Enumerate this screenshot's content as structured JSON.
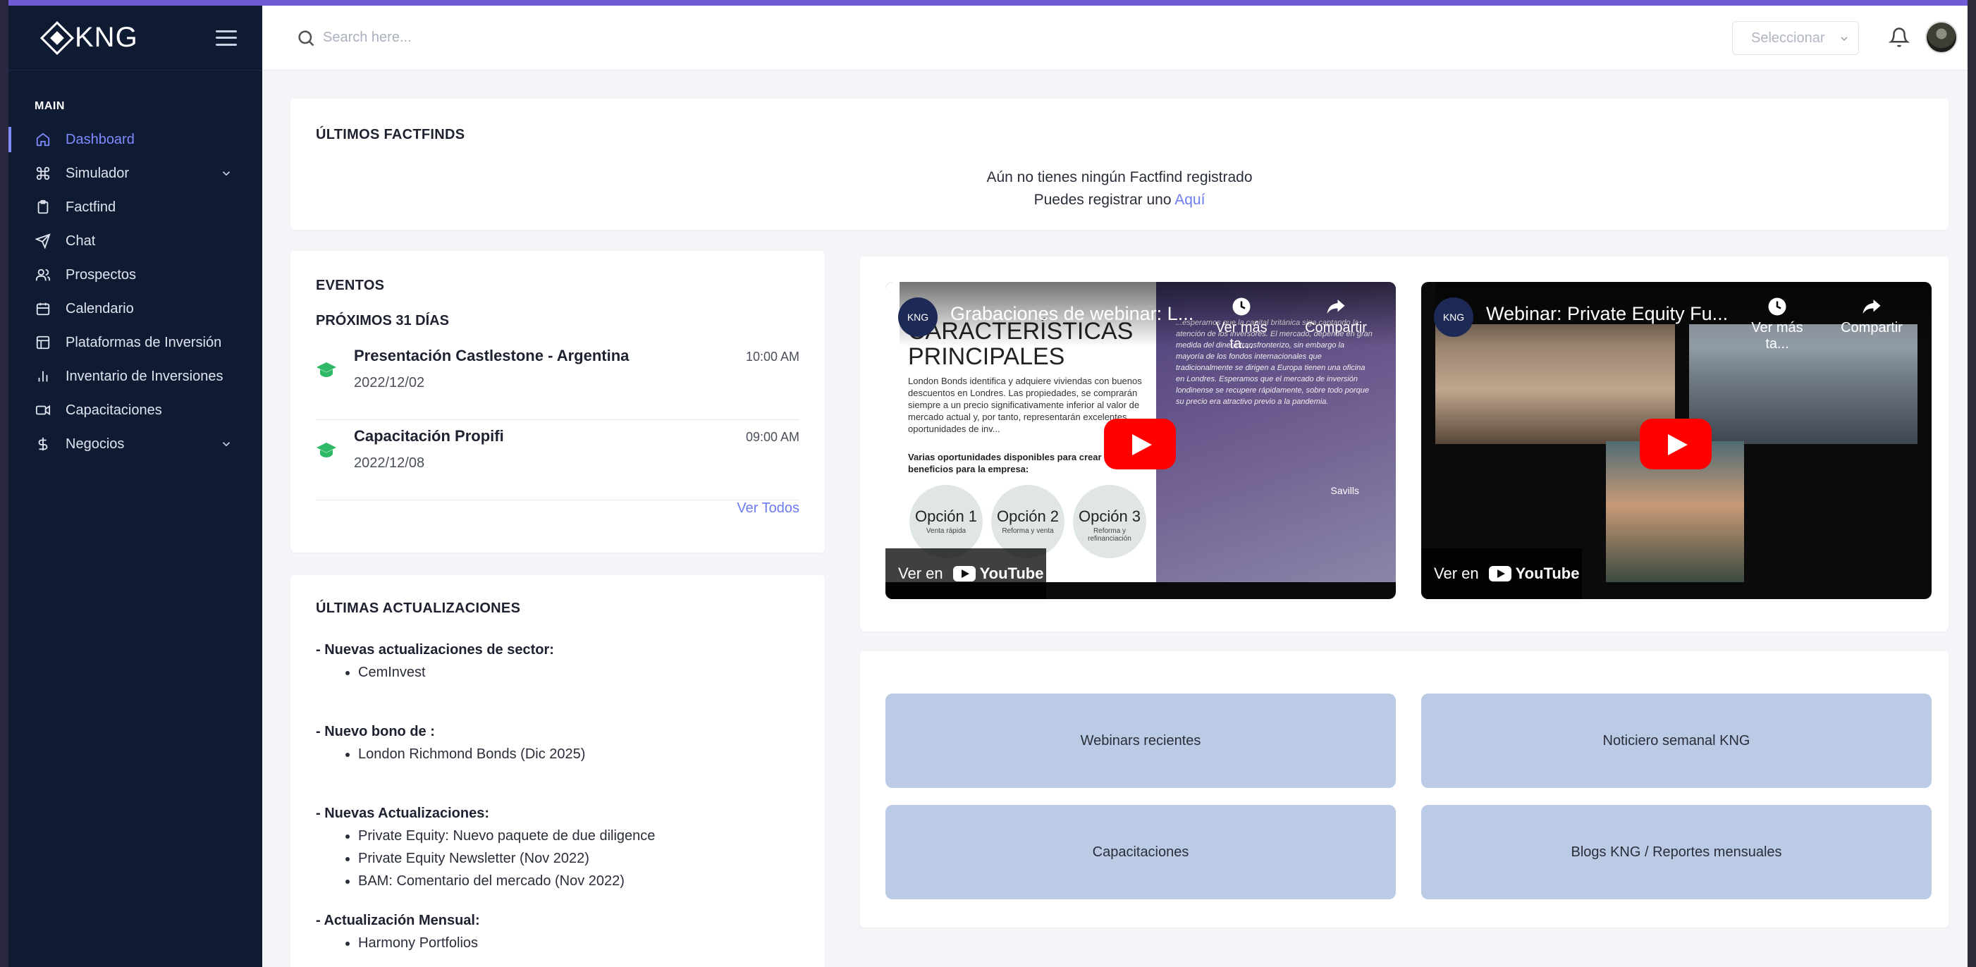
{
  "brand": {
    "name": "KNG"
  },
  "sidebar": {
    "section": "MAIN",
    "items": [
      {
        "label": "Dashboard",
        "icon": "home-icon",
        "active": true
      },
      {
        "label": "Simulador",
        "icon": "command-icon",
        "expandable": true
      },
      {
        "label": "Factfind",
        "icon": "clipboard-icon"
      },
      {
        "label": "Chat",
        "icon": "send-icon"
      },
      {
        "label": "Prospectos",
        "icon": "users-icon"
      },
      {
        "label": "Calendario",
        "icon": "calendar-icon"
      },
      {
        "label": "Plataformas de Inversión",
        "icon": "layout-icon"
      },
      {
        "label": "Inventario de Inversiones",
        "icon": "bar-chart-icon"
      },
      {
        "label": "Capacitaciones",
        "icon": "video-icon"
      },
      {
        "label": "Negocios",
        "icon": "dollar-icon",
        "expandable": true
      }
    ]
  },
  "header": {
    "search_placeholder": "Search here...",
    "select_value": "Seleccionar"
  },
  "factfinds": {
    "title": "ÚLTIMOS FACTFINDS",
    "empty_line1": "Aún no tienes ningún Factfind registrado",
    "empty_line2_prefix": "Puedes registrar uno",
    "empty_link": "Aquí"
  },
  "events": {
    "title": "EVENTOS",
    "subtitle": "PRÓXIMOS 31 DÍAS",
    "items": [
      {
        "name": "Presentación Castlestone - Argentina",
        "date": "2022/12/02",
        "time": "10:00 AM"
      },
      {
        "name": "Capacitación Propifi",
        "date": "2022/12/08",
        "time": "09:00 AM"
      }
    ],
    "view_all": "Ver Todos"
  },
  "updates": {
    "title": "ÚLTIMAS ACTUALIZACIONES",
    "groups": [
      {
        "head": "- Nuevas actualizaciones de sector:",
        "items": [
          "CemInvest"
        ]
      },
      {
        "head": "- Nuevo bono de :",
        "items": [
          "London Richmond Bonds (Dic 2025)"
        ]
      },
      {
        "head": "- Nuevas Actualizaciones:",
        "items": [
          "Private Equity: Nuevo paquete de due diligence",
          "Private Equity Newsletter (Nov 2022)",
          "BAM: Comentario del mercado (Nov 2022)"
        ]
      },
      {
        "head": "- Actualización Mensual:",
        "items": [
          "Harmony Portfolios"
        ]
      }
    ]
  },
  "videos": [
    {
      "title": "Grabaciones de webinar: L...",
      "channel": "KNG",
      "watch_later": "Ver más ta...",
      "share": "Compartir",
      "watch_on": "Ver en",
      "youtube": "YouTube",
      "slide_title": "CARACTERÍSTICAS PRINCIPALES",
      "slide_text": "London Bonds identifica y adquiere viviendas con buenos descuentos en Londres. Las propiedades, se comprarán siempre a un precio significativamente inferior al valor de mercado actual y, por tanto, representarán excelentes oportunidades de inv...",
      "slide_bold": "Varias oportunidades disponibles para crear beneficios para la empresa:",
      "options": [
        {
          "title": "Opción 1",
          "sub": "Venta rápida"
        },
        {
          "title": "Opción 2",
          "sub": "Reforma y venta"
        },
        {
          "title": "Opción 3",
          "sub": "Reforma y refinanciación"
        }
      ],
      "quote": "...esperamos que la capital británica siga captando la atención de los inversores. El mercado, depende en gran medida del dinero transfronterizo, sin embargo la mayoría de los fondos internacionales que tradicionalmente se dirigen a Europa tienen una oficina en Londres. Esperamos que el mercado de inversión londinense se recupere rápidamente, sobre todo porque su precio era atractivo previo a la pandemia.",
      "source": "Savills"
    },
    {
      "title": "Webinar: Private Equity Fu...",
      "channel": "KNG",
      "watch_later": "Ver más ta...",
      "share": "Compartir",
      "watch_on": "Ver en",
      "youtube": "YouTube"
    }
  ],
  "tiles": [
    "Webinars recientes",
    "Noticiero semanal KNG",
    "Capacitaciones",
    "Blogs KNG / Reportes mensuales"
  ],
  "colors": {
    "sidebar": "#0f1a33",
    "accent": "#7f8cff",
    "tile": "#bccbe5",
    "event_icon": "#2fb866"
  }
}
